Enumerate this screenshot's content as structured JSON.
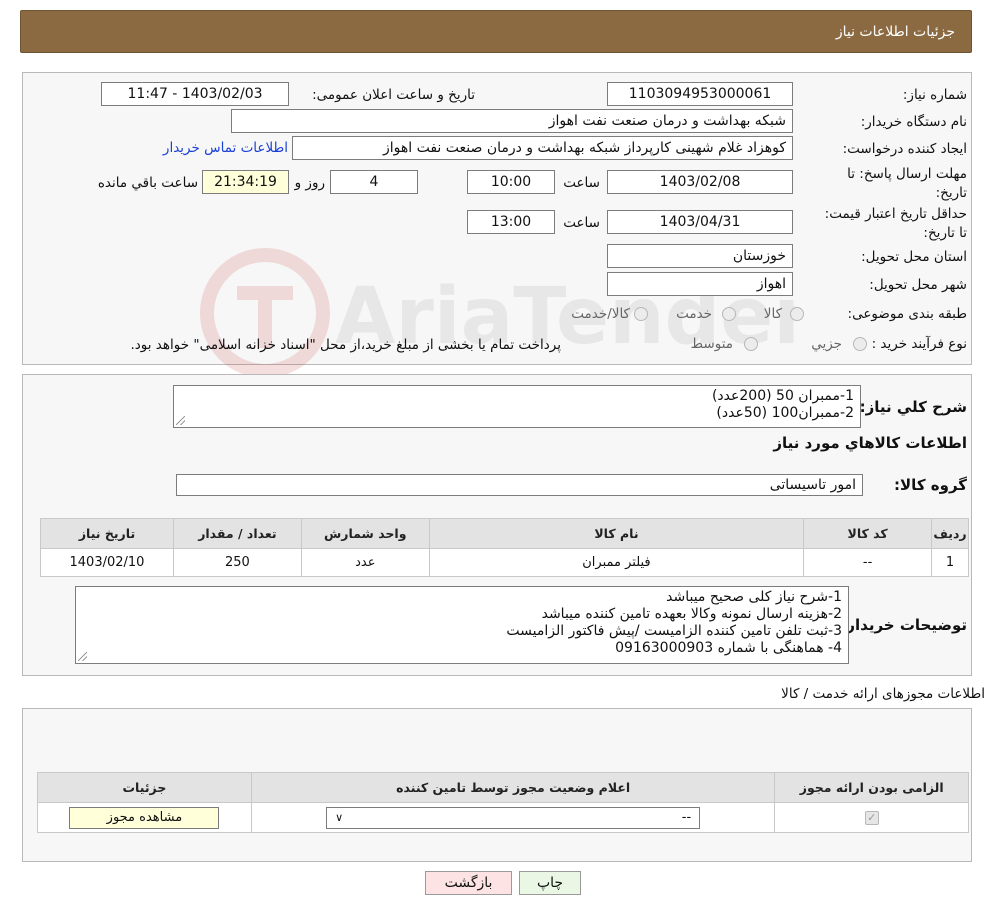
{
  "header": {
    "title": "جزئیات اطلاعات نیاز"
  },
  "details": {
    "need_number_label": "شماره نیاز:",
    "need_number": "1103094953000061",
    "announce_label": "تاریخ و ساعت اعلان عمومی:",
    "announce_value": "1403/02/03 - 11:47",
    "buyer_org_label": "نام دستگاه خریدار:",
    "buyer_org": "شبکه بهداشت و درمان صنعت نفت اهواز",
    "creator_label": "ایجاد کننده درخواست:",
    "creator": "کوهزاد غلام شهینی کارپرداز شبکه بهداشت و درمان صنعت نفت اهواز",
    "contact_link": "اطلاعات تماس خریدار",
    "deadline_label": "مهلت ارسال پاسخ: تا تاریخ:",
    "deadline_date": "1403/02/08",
    "time_label": "ساعت",
    "deadline_time": "10:00",
    "days_value": "4",
    "days_label": "روز و",
    "remaining_time": "21:34:19",
    "remaining_label": "ساعت باقي مانده",
    "validity_label": "حداقل تاریخ اعتبار قیمت: تا تاریخ:",
    "validity_date": "1403/04/31",
    "validity_time": "13:00",
    "province_label": "استان محل تحویل:",
    "province": "خوزستان",
    "city_label": "شهر محل تحویل:",
    "city": "اهواز",
    "category_label": "طبقه بندی موضوعی:",
    "category_options": [
      "کالا",
      "خدمت",
      "کالا/خدمت"
    ],
    "purchase_type_label": "نوع فرآیند خرید :",
    "purchase_options": [
      "جزیي",
      "متوسط"
    ],
    "purchase_note": "پرداخت تمام یا بخشی از مبلغ خرید،از محل \"اسناد خزانه اسلامی\" خواهد بود."
  },
  "needs": {
    "summary_label": "شرح کلي نیاز:",
    "summary_lines": [
      "1-ممبران 50 (200عدد)",
      "2-ممبران100 (50عدد)"
    ],
    "goods_info_title": "اطلاعات کالاهاي مورد نیاز",
    "group_label": "گروه کالا:",
    "group_value": "امور تاسیساتی",
    "table": {
      "headers": [
        "ردیف",
        "کد کالا",
        "نام کالا",
        "واحد شمارش",
        "تعداد / مقدار",
        "تاریخ نیاز"
      ],
      "rows": [
        [
          "1",
          "--",
          "فیلتر ممبران",
          "عدد",
          "250",
          "1403/02/10"
        ]
      ]
    },
    "buyer_notes_label": "توضیحات خریدار:",
    "buyer_notes_lines": [
      "1-شرح نیاز کلی صحیح میباشد",
      "2-هزینه ارسال نمونه وکالا بعهده تامین کننده میباشد",
      "3-ثبت تلفن تامین کننده الزامیست /پیش فاکتور الزامیست",
      "4- هماهنگی با شماره 09163000903"
    ]
  },
  "licenses": {
    "title": "اطلاعات مجوزهای ارائه خدمت / کالا",
    "headers": [
      "الزامی بودن ارائه مجوز",
      "اعلام وضعیت مجوز توسط تامین کننده",
      "جزئیات"
    ],
    "select_value": "--",
    "view_button": "مشاهده مجوز"
  },
  "actions": {
    "print": "چاپ",
    "back": "بازگشت"
  },
  "watermark": {
    "text": "AriaTender.neT"
  },
  "colors": {
    "header_bg": "#8b6a42",
    "link": "#1a3fd6",
    "yellow_field": "#ffffd9",
    "back_button": "#fde3e3",
    "print_button": "#eaf7e4"
  }
}
